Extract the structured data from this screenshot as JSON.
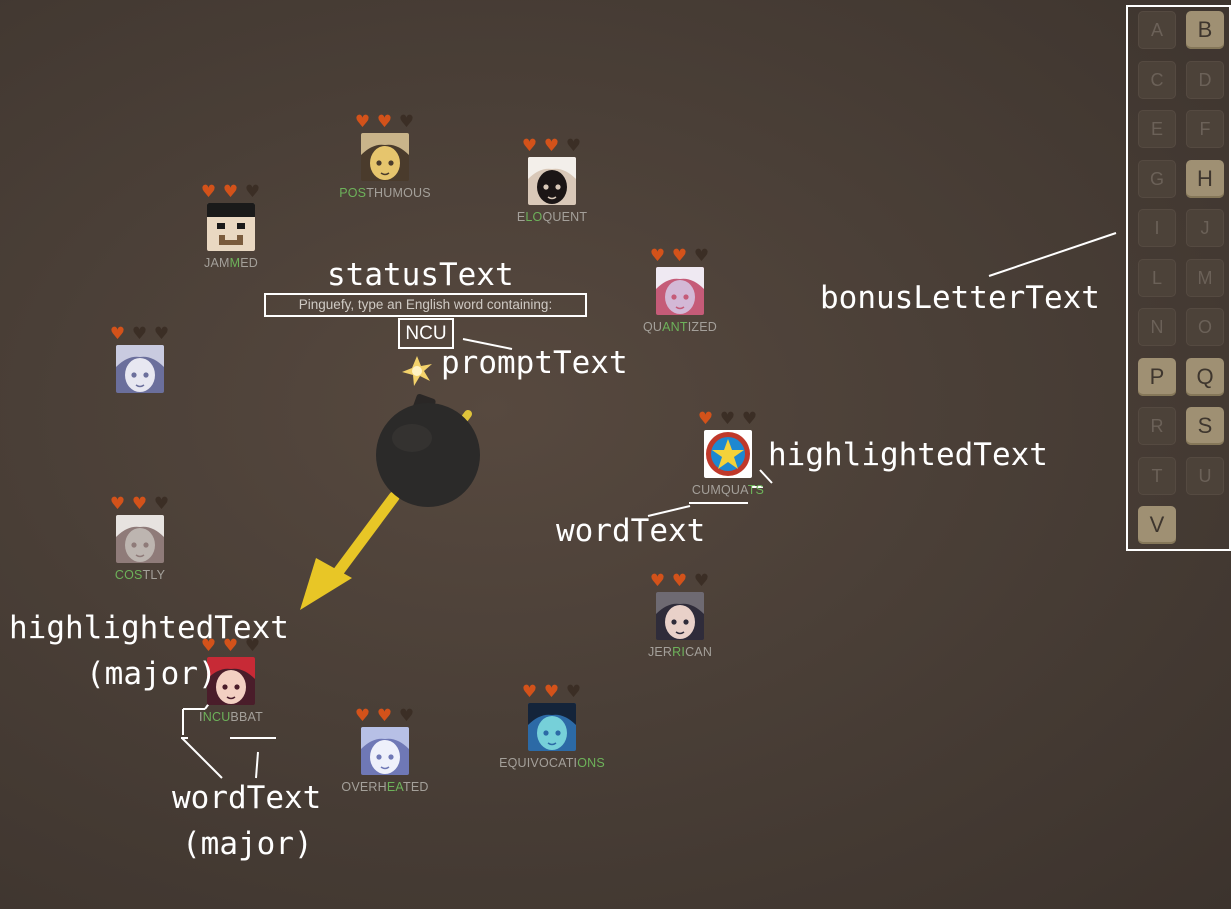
{
  "status_text": "Pinguefy, type an English word containing:",
  "prompt_text": "NCU",
  "annotations": {
    "status": "statusText",
    "prompt": "promptText",
    "highlighted": "highlightedText",
    "word": "wordText",
    "bonus": "bonusLetterText",
    "highlighted_major_1": "highlightedText",
    "highlighted_major_2": "(major)",
    "word_major_1": "wordText",
    "word_major_2": "(major)"
  },
  "players": [
    {
      "id": "posthumous",
      "lives": 2,
      "max_lives": 3,
      "word_pre": "",
      "word_hl": "POS",
      "word_post": "THUMOUS"
    },
    {
      "id": "eloquent",
      "lives": 2,
      "max_lives": 3,
      "word_pre": "E",
      "word_hl": "LO",
      "word_post": "QUENT"
    },
    {
      "id": "jammed",
      "lives": 2,
      "max_lives": 3,
      "word_pre": "JAM",
      "word_hl": "M",
      "word_post": "ED"
    },
    {
      "id": "quantized",
      "lives": 2,
      "max_lives": 3,
      "word_pre": "QU",
      "word_hl": "ANT",
      "word_post": "IZED"
    },
    {
      "id": "noword",
      "lives": 1,
      "max_lives": 3,
      "word_pre": "",
      "word_hl": "",
      "word_post": ""
    },
    {
      "id": "cumquats",
      "lives": 1,
      "max_lives": 3,
      "word_pre": "CUMQUA",
      "word_hl": "TS",
      "word_post": ""
    },
    {
      "id": "costly",
      "lives": 2,
      "max_lives": 3,
      "word_pre": "",
      "word_hl": "COS",
      "word_post": "TLY"
    },
    {
      "id": "jerrican",
      "lives": 2,
      "max_lives": 3,
      "word_pre": "JER",
      "word_hl": "RI",
      "word_post": "CAN"
    },
    {
      "id": "incubbat",
      "lives": 2,
      "max_lives": 3,
      "word_pre": "I",
      "word_hl": "NCU",
      "word_post": "BBAT"
    },
    {
      "id": "equivocations",
      "lives": 2,
      "max_lives": 3,
      "word_pre": "EQUIVOCATI",
      "word_hl": "ONS",
      "word_post": ""
    },
    {
      "id": "overheated",
      "lives": 2,
      "max_lives": 3,
      "word_pre": "OVERH",
      "word_hl": "EA",
      "word_post": "TED"
    }
  ],
  "bonus_letters": [
    {
      "letter": "A",
      "active": false
    },
    {
      "letter": "B",
      "active": true
    },
    {
      "letter": "C",
      "active": false
    },
    {
      "letter": "D",
      "active": false
    },
    {
      "letter": "E",
      "active": false
    },
    {
      "letter": "F",
      "active": false
    },
    {
      "letter": "G",
      "active": false
    },
    {
      "letter": "H",
      "active": true
    },
    {
      "letter": "I",
      "active": false
    },
    {
      "letter": "J",
      "active": false
    },
    {
      "letter": "L",
      "active": false
    },
    {
      "letter": "M",
      "active": false
    },
    {
      "letter": "N",
      "active": false
    },
    {
      "letter": "O",
      "active": false
    },
    {
      "letter": "P",
      "active": true
    },
    {
      "letter": "Q",
      "active": true
    },
    {
      "letter": "R",
      "active": false
    },
    {
      "letter": "S",
      "active": true
    },
    {
      "letter": "T",
      "active": false
    },
    {
      "letter": "U",
      "active": false
    },
    {
      "letter": "V",
      "active": true
    }
  ],
  "icons": {
    "heart_full": "heart-icon",
    "heart_empty": "heart-empty-icon",
    "bomb": "bomb-icon",
    "arrow": "turn-arrow-icon",
    "spark": "fuse-spark-icon"
  },
  "colors": {
    "heart_full": "#d3521a",
    "heart_empty": "#3b2e25",
    "highlight": "#6db25a",
    "word": "#a4a09a",
    "arrow": "#e8c626",
    "tile_active": "#9f9073"
  }
}
